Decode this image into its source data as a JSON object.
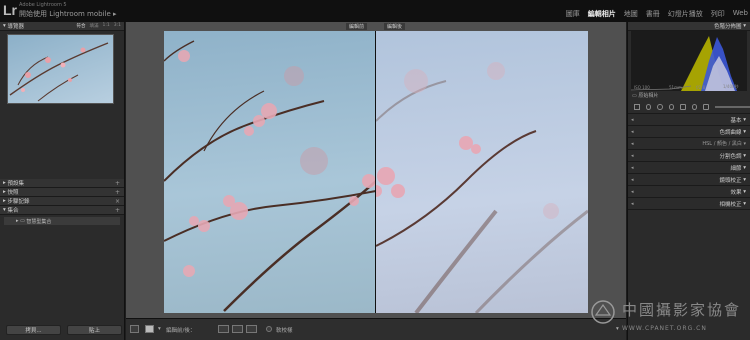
{
  "app": {
    "logo": "Lr",
    "name": "Adobe Lightroom 5",
    "identity": "開始使用 Lightroom mobile"
  },
  "modules": [
    "圖庫",
    "編輯相片",
    "地圖",
    "書冊",
    "幻燈片播放",
    "列印",
    "Web"
  ],
  "active_module": "編輯相片",
  "left_panel": {
    "navigator": {
      "title": "導覽器",
      "options": [
        "符合",
        "填滿",
        "1:1",
        "3:1"
      ]
    },
    "panels": [
      "預設集",
      "快照",
      "步驟記錄",
      "集合"
    ],
    "collection_item": "智慧型集合",
    "buttons": {
      "copy": "拷貝...",
      "paste": "貼上"
    }
  },
  "compare": {
    "before": "編輯前",
    "after": "編輯後"
  },
  "toolbar": {
    "label": "編輯前/後：",
    "soft_proof": "軟校樣"
  },
  "right_panel": {
    "histogram_title": "色階分佈圖",
    "histo_iso": "ISO 100",
    "histo_focal": "51mm",
    "histo_aperture": "f/2.8",
    "histo_shutter": "1/400秒",
    "original_photo": "原始相片",
    "panels": [
      "基本",
      "色調曲線",
      "分割色調",
      "細節",
      "鏡頭校正",
      "效果",
      "相機校正"
    ],
    "hsl": {
      "a": "HSL",
      "b": "顏色",
      "c": "黑白"
    }
  },
  "watermark": {
    "text": "中國攝影家協會",
    "url": "WWW.CPANET.ORG.CN"
  },
  "colors": {
    "accent": "#d7d7d7",
    "panel": "#2b2b2b",
    "canvas": "#505050"
  }
}
